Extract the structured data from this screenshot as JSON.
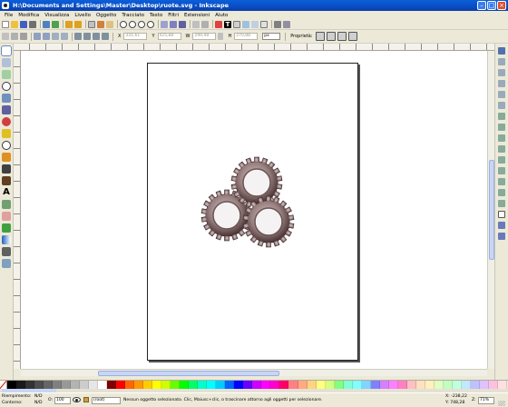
{
  "window": {
    "title": "H:\\Documents and Settings\\Master\\Desktop\\ruote.svg - Inkscape"
  },
  "menu": [
    "File",
    "Modifica",
    "Visualizza",
    "Livello",
    "Oggetto",
    "Tracciato",
    "Testo",
    "Filtri",
    "Estensioni",
    "Aiuto"
  ],
  "toolbar": {
    "x": "331,61",
    "y": "425,88",
    "w": "299,98",
    "h": "270,88",
    "unit": "px",
    "prefs_label": "Proprietà:"
  },
  "status": {
    "fill_label": "Riempimento:",
    "fill_value": "N/D",
    "stroke_label": "Contorno:",
    "stroke_value": "N/D",
    "opacity_label": "O:",
    "opacity_value": "100",
    "layer": "(root)",
    "message": "Nessun oggetto selezionato. Clic, Maiusc+clic, o trascinare attorno agli oggetti per selezionare.",
    "cursor_x": "X: -238,22",
    "cursor_y": "Y: 748,28",
    "zoom_label": "Z:",
    "zoom": "71%"
  },
  "icons": {
    "left_tools": [
      "selector-icon",
      "node-icon",
      "tweak-icon",
      "zoom-icon",
      "measure-icon",
      "rect-icon",
      "3dbox-icon",
      "ellipse-icon",
      "star-icon",
      "spiral-icon",
      "pencil-icon",
      "pen-icon",
      "calligraphy-icon",
      "text-icon",
      "spray-icon",
      "eraser-icon",
      "bucket-icon",
      "gradient-icon",
      "dropper-icon",
      "connector-icon"
    ]
  },
  "colors": {
    "palette": [
      "#000000",
      "#1a1a1a",
      "#333333",
      "#4d4d4d",
      "#666666",
      "#808080",
      "#999999",
      "#b3b3b3",
      "#cccccc",
      "#e6e6e6",
      "#ffffff",
      "#800000",
      "#ff0000",
      "#ff6600",
      "#ff9900",
      "#ffcc00",
      "#ffff00",
      "#ccff00",
      "#66ff00",
      "#00ff00",
      "#00ff66",
      "#00ffcc",
      "#00ffff",
      "#00ccff",
      "#0066ff",
      "#0000ff",
      "#6600ff",
      "#cc00ff",
      "#ff00ff",
      "#ff00cc",
      "#ff0066",
      "#ff8080",
      "#ffaa80",
      "#ffd480",
      "#ffff80",
      "#d4ff80",
      "#80ff80",
      "#80ffd4",
      "#80ffff",
      "#80d4ff",
      "#8080ff",
      "#d480ff",
      "#ff80ff",
      "#ff80c0",
      "#ffc0c0",
      "#ffe0c0",
      "#fff0c0",
      "#e0ffc0",
      "#c0ffc0",
      "#c0ffe0",
      "#c0e8ff",
      "#c0c0ff",
      "#e0c0ff",
      "#ffc0e0",
      "#ffe0e0"
    ],
    "gear_dark": "#4a3a3a",
    "gear_light": "#c8b8b8"
  }
}
